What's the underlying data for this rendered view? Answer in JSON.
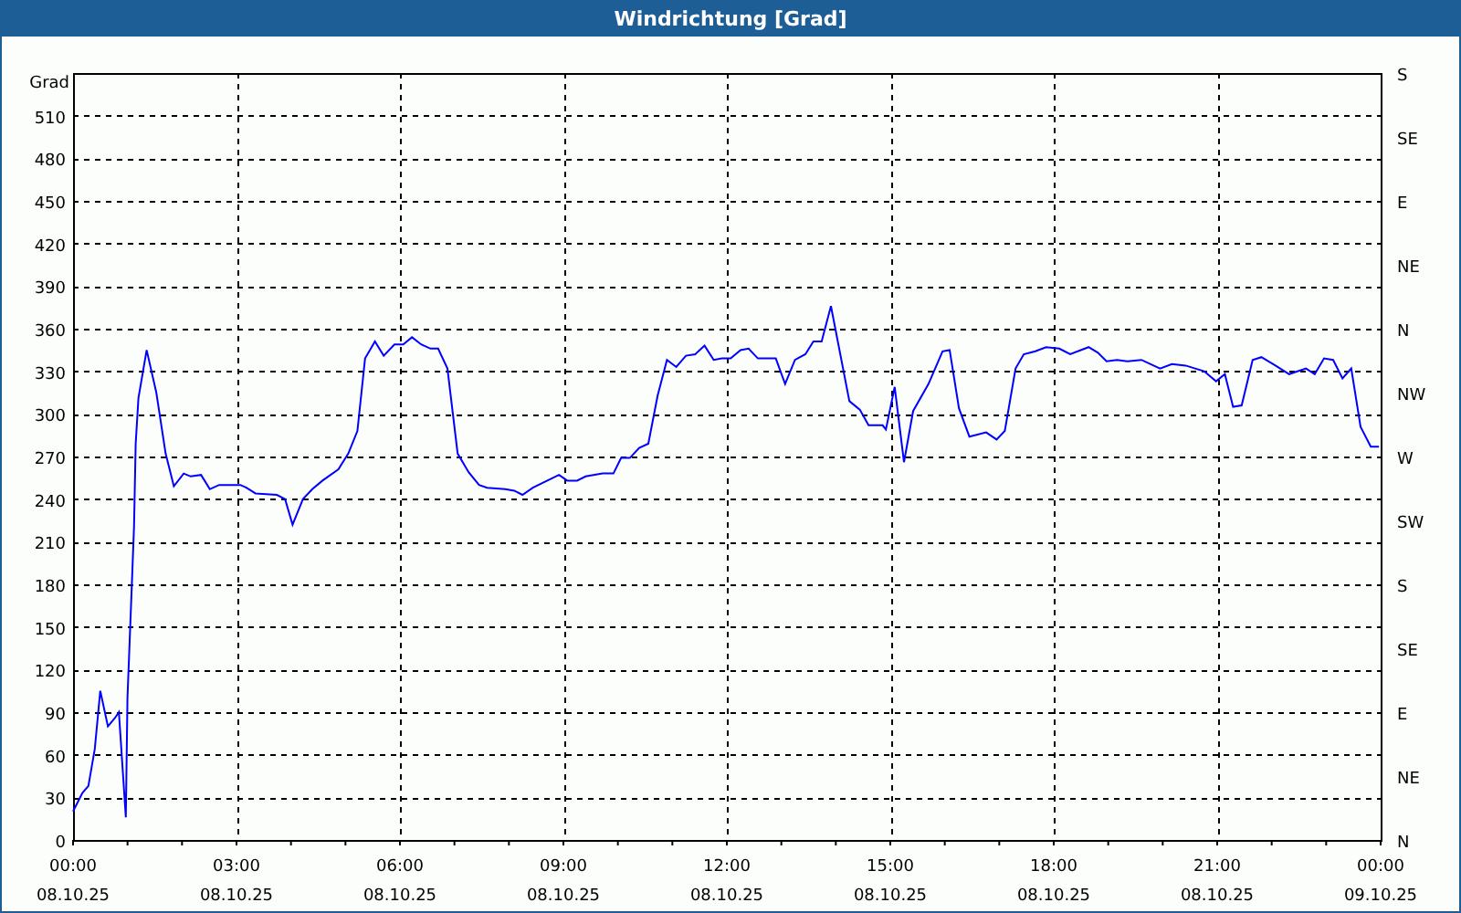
{
  "window": {
    "title": "Windrichtung [Grad]"
  },
  "chart": {
    "compass_labels": [
      "S",
      "SE",
      "E",
      "NE",
      "N",
      "NW",
      "W",
      "SW",
      "S",
      "SE",
      "E",
      "NE",
      "N"
    ],
    "date_labels": [
      "08.10.25",
      "08.10.25",
      "08.10.25",
      "08.10.25",
      "08.10.25",
      "08.10.25",
      "08.10.25",
      "08.10.25",
      "09.10.25"
    ],
    "chart_data": {
      "type": "line",
      "grid": true,
      "ylabel": "Grad",
      "xlim": [
        0,
        24
      ],
      "ylim": [
        0,
        540
      ],
      "yticks": [
        0,
        30,
        60,
        90,
        120,
        150,
        180,
        210,
        240,
        270,
        300,
        330,
        360,
        390,
        420,
        450,
        480,
        510
      ],
      "xticks": [
        {
          "value": 0,
          "label": "00:00"
        },
        {
          "value": 3,
          "label": "03:00"
        },
        {
          "value": 6,
          "label": "06:00"
        },
        {
          "value": 9,
          "label": "09:00"
        },
        {
          "value": 12,
          "label": "12:00"
        },
        {
          "value": 15,
          "label": "15:00"
        },
        {
          "value": 18,
          "label": "18:00"
        },
        {
          "value": 21,
          "label": "21:00"
        },
        {
          "value": 24,
          "label": "00:00"
        }
      ],
      "x": [
        0,
        0.17,
        0.28,
        0.4,
        0.5,
        0.64,
        0.77,
        0.84,
        0.97,
        1.0,
        1.08,
        1.12,
        1.15,
        1.2,
        1.35,
        1.53,
        1.7,
        1.85,
        2.03,
        2.16,
        2.35,
        2.51,
        2.68,
        3.07,
        3.18,
        3.35,
        3.74,
        3.89,
        4.03,
        4.22,
        4.39,
        4.58,
        4.87,
        5.05,
        5.22,
        5.36,
        5.54,
        5.7,
        5.9,
        6.06,
        6.22,
        6.39,
        6.56,
        6.7,
        6.87,
        7.06,
        7.26,
        7.45,
        7.6,
        7.93,
        8.1,
        8.25,
        8.44,
        8.92,
        9.07,
        9.25,
        9.41,
        9.72,
        9.92,
        10.06,
        10.22,
        10.39,
        10.56,
        10.73,
        10.9,
        11.07,
        11.25,
        11.42,
        11.59,
        11.76,
        11.91,
        12.07,
        12.25,
        12.4,
        12.57,
        12.9,
        13.07,
        13.25,
        13.44,
        13.59,
        13.74,
        13.91,
        14.25,
        14.44,
        14.6,
        14.86,
        14.92,
        15.08,
        15.25,
        15.42,
        15.7,
        15.96,
        16.09,
        16.26,
        16.45,
        16.76,
        16.95,
        17.1,
        17.3,
        17.45,
        17.66,
        17.86,
        18.1,
        18.3,
        18.64,
        18.81,
        18.97,
        19.16,
        19.35,
        19.61,
        19.95,
        20.17,
        20.42,
        20.76,
        20.98,
        21.14,
        21.29,
        21.45,
        21.65,
        21.81,
        22.07,
        22.32,
        22.63,
        22.79,
        22.96,
        23.13,
        23.3,
        23.46,
        23.63,
        23.82,
        23.97
      ],
      "series": [
        {
          "color": "#0000ff",
          "values": [
            20,
            33,
            38,
            64,
            105,
            80,
            86,
            90,
            16,
            100,
            180,
            221,
            279,
            311,
            345,
            315,
            272,
            249,
            258,
            256,
            257,
            247,
            250,
            250,
            248,
            244,
            243,
            240,
            222,
            240,
            247,
            253,
            261,
            272,
            288,
            339,
            351,
            341,
            349,
            349,
            354,
            349,
            346,
            346,
            332,
            272,
            259,
            250,
            248,
            247,
            246,
            243,
            248,
            257,
            253,
            253,
            256,
            258,
            258,
            269,
            269,
            276,
            279,
            313,
            338,
            333,
            341,
            342,
            348,
            338,
            339,
            339,
            345,
            346,
            339,
            339,
            321,
            338,
            342,
            351,
            351,
            376,
            309,
            303,
            292,
            292,
            289,
            319,
            266,
            302,
            321,
            344,
            345,
            304,
            284,
            287,
            282,
            288,
            332,
            342,
            344,
            347,
            346,
            342,
            347,
            343,
            337,
            338,
            337,
            338,
            332,
            335,
            334,
            330,
            323,
            328,
            305,
            306,
            338,
            340,
            334,
            328,
            332,
            328,
            339,
            338,
            325,
            332,
            291,
            277,
            277
          ]
        }
      ]
    }
  }
}
